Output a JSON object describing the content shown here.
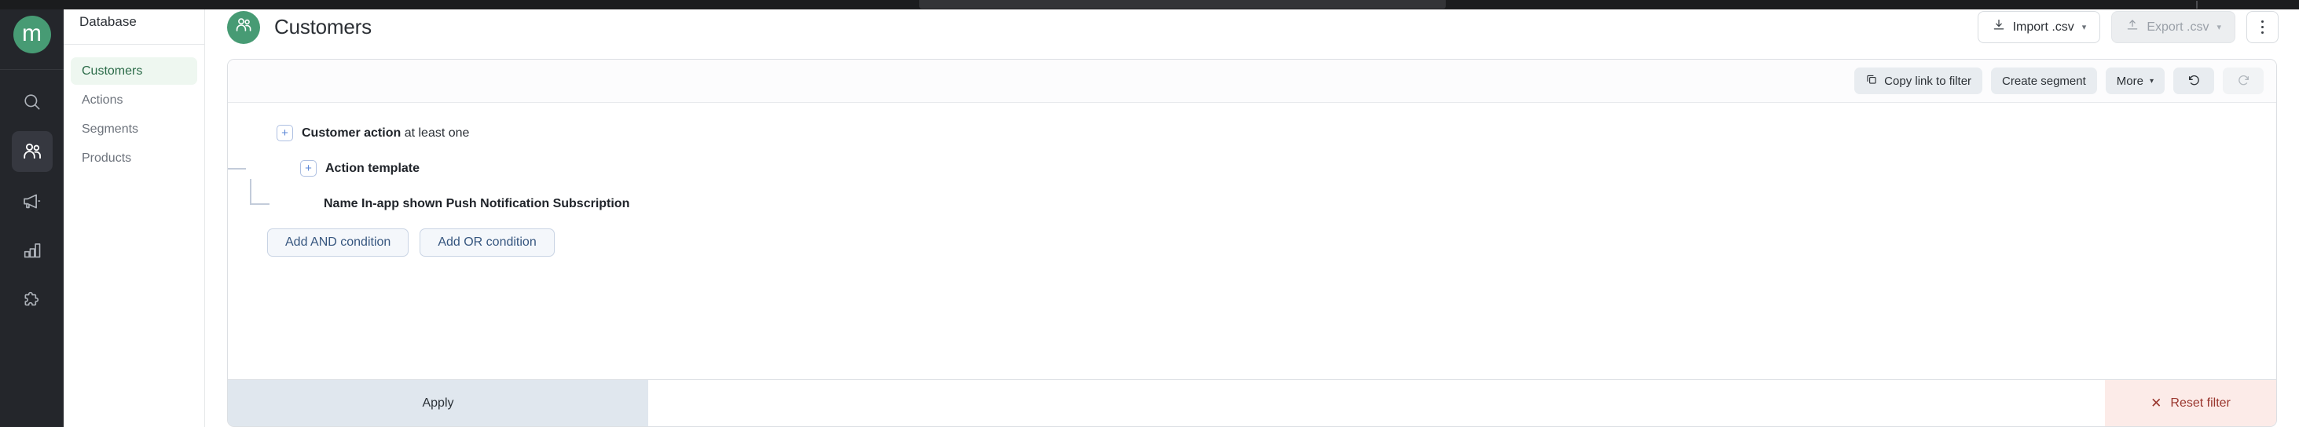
{
  "brand": {
    "logo_letter": "m",
    "logo_color": "#479b74"
  },
  "rail": {
    "items": [
      {
        "name": "search-icon",
        "label": "Search",
        "active": false
      },
      {
        "name": "customers-icon",
        "label": "Customers",
        "active": true
      },
      {
        "name": "campaigns-icon",
        "label": "Campaigns",
        "active": false
      },
      {
        "name": "analytics-icon",
        "label": "Analytics",
        "active": false
      },
      {
        "name": "integrations-icon",
        "label": "Integrations",
        "active": false
      }
    ]
  },
  "sidebar": {
    "title": "Database",
    "items": [
      {
        "label": "Customers",
        "active": true
      },
      {
        "label": "Actions",
        "active": false
      },
      {
        "label": "Segments",
        "active": false
      },
      {
        "label": "Products",
        "active": false
      }
    ]
  },
  "header": {
    "title": "Customers",
    "import_label": "Import .csv",
    "export_label": "Export .csv",
    "export_disabled": true,
    "caret": "▾",
    "overflow_label": "More options"
  },
  "filter_toolbar": {
    "copy_link_label": "Copy link to filter",
    "create_segment_label": "Create segment",
    "more_label": "More",
    "more_caret": "▾",
    "undo_label": "Undo",
    "redo_label": "Redo",
    "redo_disabled": true
  },
  "filter_tree": {
    "nodes": [
      {
        "level": 1,
        "has_plus": true,
        "plus": "+",
        "bold_text": "Customer action",
        "light_text": " at least one"
      },
      {
        "level": 2,
        "has_plus": true,
        "plus": "+",
        "bold_text": "Action template",
        "light_text": ""
      },
      {
        "level": 3,
        "has_plus": false,
        "plus": "",
        "bold_text": "Name In-app shown Push Notification Subscription",
        "light_text": ""
      }
    ],
    "add_and_label": "Add AND condition",
    "add_or_label": "Add OR condition"
  },
  "footer": {
    "apply_label": "Apply",
    "reset_label": "Reset filter",
    "reset_icon": "✕",
    "apply_bg": "#e0e7ee",
    "reset_bg": "#fcebe8",
    "reset_color": "#99352d"
  }
}
